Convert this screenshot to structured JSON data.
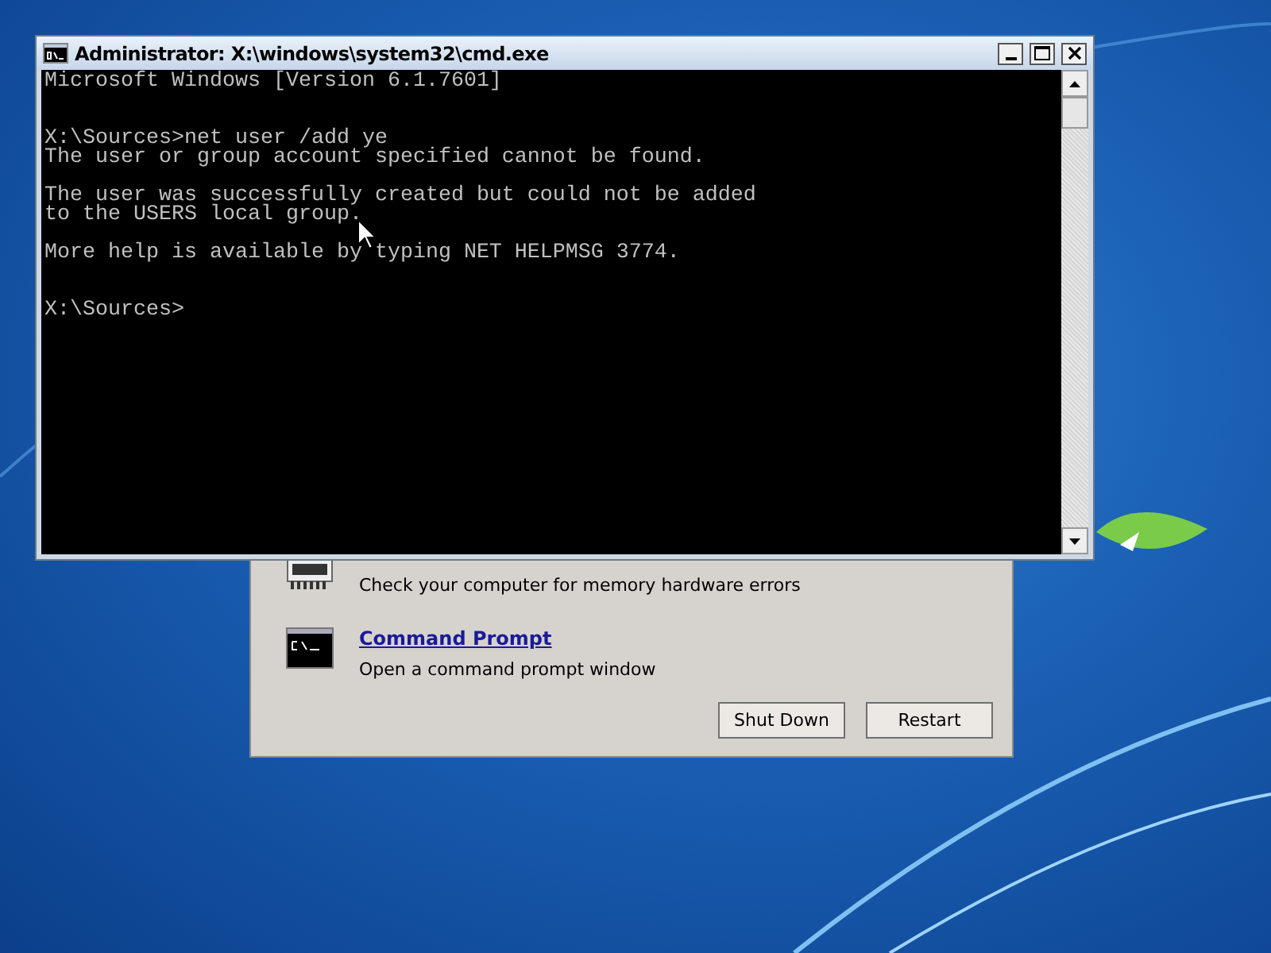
{
  "console_window": {
    "title": "Administrator: X:\\windows\\system32\\cmd.exe",
    "lines": [
      {
        "kind": "text",
        "text": "Microsoft Windows [Version 6.1.7601]"
      },
      {
        "kind": "blank"
      },
      {
        "kind": "blank"
      },
      {
        "kind": "text",
        "text": "X:\\Sources>net user /add ye"
      },
      {
        "kind": "text",
        "text": "The user or group account specified cannot be found."
      },
      {
        "kind": "blank"
      },
      {
        "kind": "text",
        "text": "The user was successfully created but could not be added"
      },
      {
        "kind": "text",
        "text": "to the USERS local group."
      },
      {
        "kind": "blank"
      },
      {
        "kind": "text",
        "text": "More help is available by typing NET HELPMSG 3774."
      },
      {
        "kind": "blank"
      },
      {
        "kind": "blank"
      },
      {
        "kind": "text",
        "text": "X:\\Sources>"
      }
    ]
  },
  "recovery_dialog": {
    "tools": [
      {
        "kind": "memory",
        "description": "Check your computer for memory hardware errors"
      },
      {
        "kind": "console",
        "link": "Command Prompt",
        "description": "Open a command prompt window"
      }
    ],
    "buttons": [
      "Shut Down",
      "Restart"
    ]
  }
}
